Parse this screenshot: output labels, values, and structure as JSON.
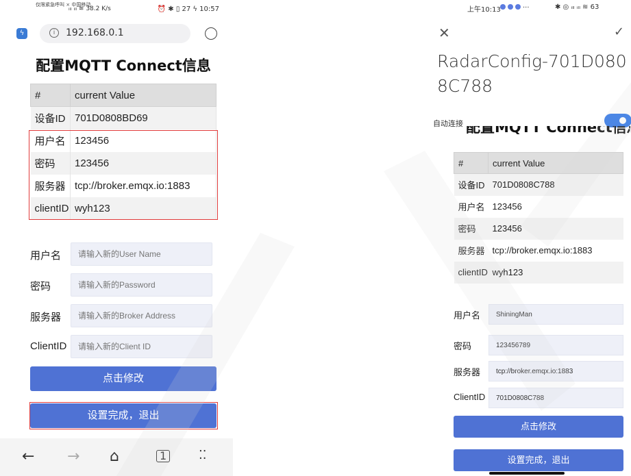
{
  "left": {
    "status": {
      "carrier": "仅限紧急呼叫 × 中国移动",
      "signal": "ᵢₗₗ ᵢₗₗ ≋ 38.2 K/s",
      "right": "⏰ ✱ ▯ 27 ϟ 10:57"
    },
    "browser": {
      "url": "192.168.0.1"
    },
    "title": "配置MQTT Connect信息",
    "table": {
      "head": [
        "#",
        "current Value"
      ],
      "rows": [
        [
          "设备ID",
          "701D0808BD69"
        ],
        [
          "用户名",
          "123456"
        ],
        [
          "密码",
          "123456"
        ],
        [
          "服务器",
          "tcp://broker.emqx.io:1883"
        ],
        [
          "clientID",
          "wyh123"
        ]
      ]
    },
    "form": [
      {
        "label": "用户名",
        "placeholder": "请输入新的User Name"
      },
      {
        "label": "密码",
        "placeholder": "请输入新的Password"
      },
      {
        "label": "服务器",
        "placeholder": "请输入新的Broker Address"
      },
      {
        "label": "ClientID",
        "placeholder": "请输入新的Client ID"
      }
    ],
    "modify_label": "点击修改",
    "exit_label": "设置完成，退出"
  },
  "right": {
    "status": {
      "time": "上午10:13",
      "more": "···",
      "icons": "✱ ◎ ᵢₗₗ ᵢₗₗ ≋ 63"
    },
    "dialog_title": "RadarConfig-701D0808C788",
    "auto_connect": "自动连接",
    "title": "配置MQTT Connect信息",
    "table": {
      "head": [
        "#",
        "current Value"
      ],
      "rows": [
        [
          "设备ID",
          "701D0808C788"
        ],
        [
          "用户名",
          "123456"
        ],
        [
          "密码",
          "123456"
        ],
        [
          "服务器",
          "tcp://broker.emqx.io:1883"
        ],
        [
          "clientID",
          "wyh123"
        ]
      ]
    },
    "form": [
      {
        "label": "用户名",
        "value": "ShiningMan"
      },
      {
        "label": "密码",
        "value": "123456789"
      },
      {
        "label": "服务器",
        "value": "tcp://broker.emqx.io:1883"
      },
      {
        "label": "ClientID",
        "value": "701D0808C788"
      }
    ],
    "modify_label": "点击修改",
    "exit_label": "设置完成，退出"
  },
  "colors": {
    "button": "#4f72d4",
    "highlight": "#e03a3a",
    "toggle": "#3479e8"
  }
}
